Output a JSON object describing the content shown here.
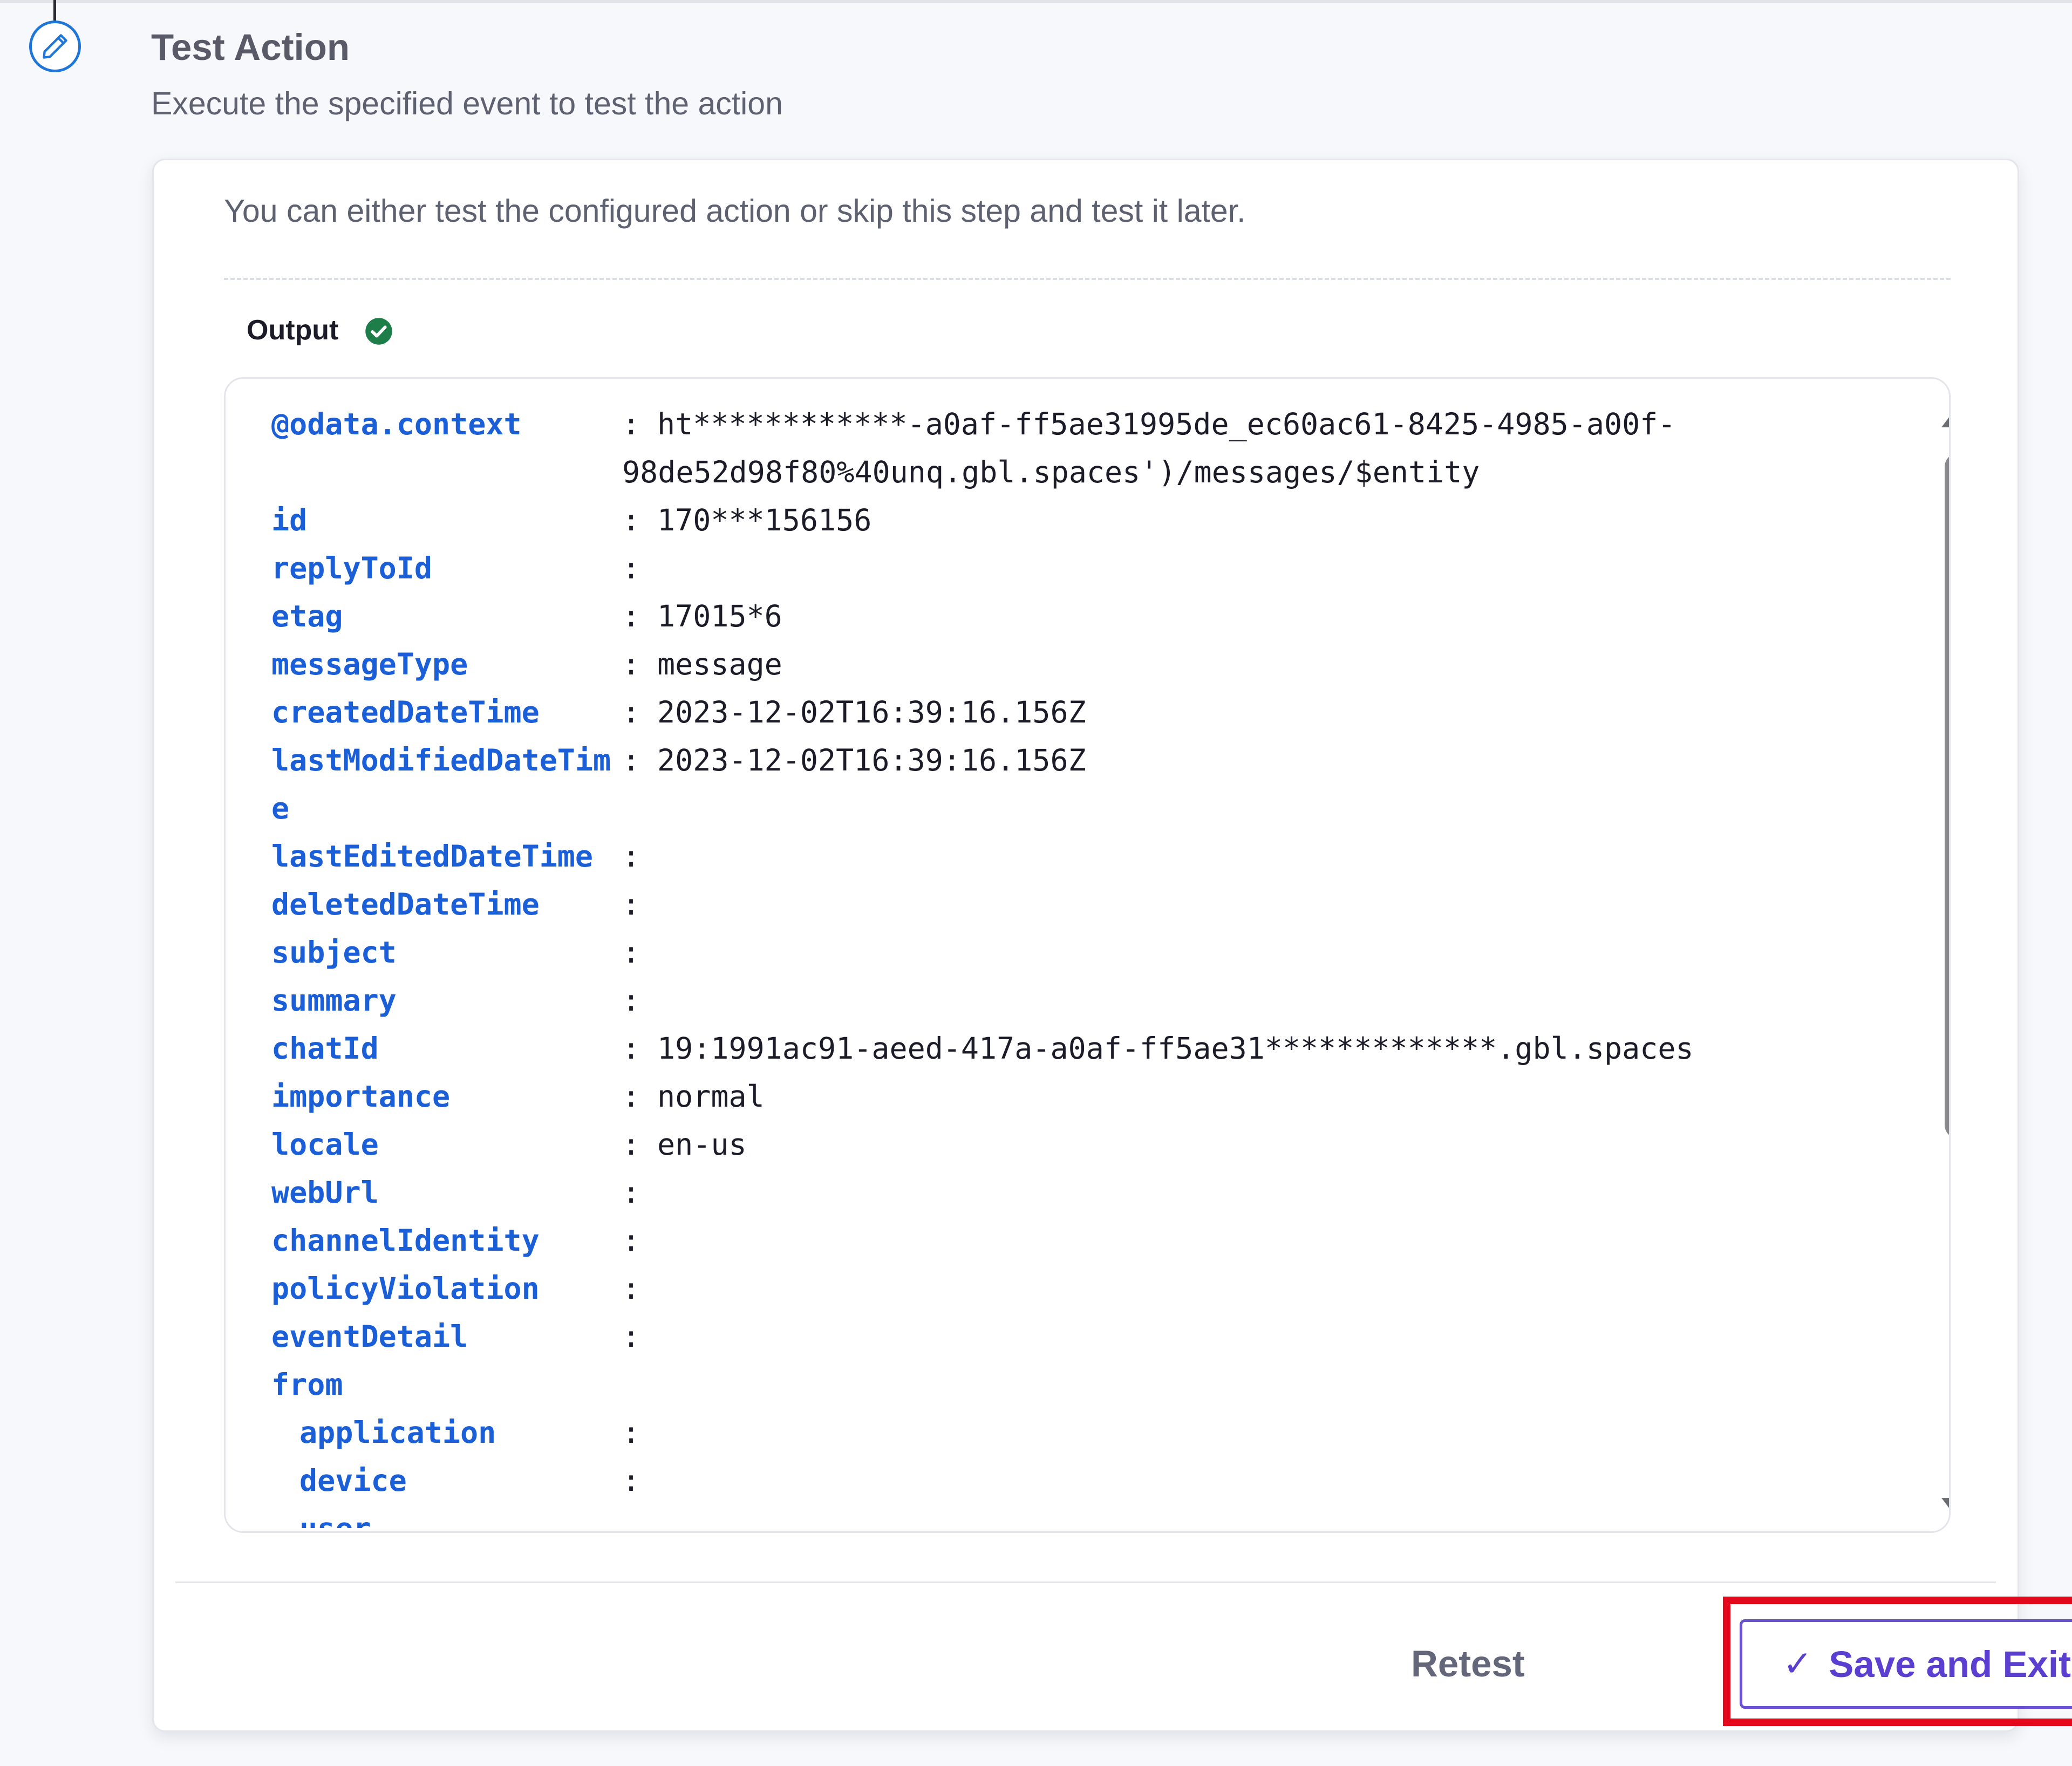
{
  "step": {
    "title": "Test Action",
    "description": "Execute the specified event to test the action",
    "icon": "pencil-icon",
    "accent_color": "#1f76d8"
  },
  "card": {
    "intro": "You can either test the configured action or skip this step and test it later.",
    "output_label": "Output",
    "output_status_icon": "check-circle-icon",
    "output_status_color": "#1e7e4a"
  },
  "output": {
    "rows": [
      {
        "key": "@odata.context",
        "value": "ht************-a0af-ff5ae31995de_ec60ac61-8425-4985-a00f-"
      },
      {
        "key": "",
        "value": "98de52d98f80%40unq.gbl.spaces')/messages/$entity"
      },
      {
        "key": "id",
        "value": "170***156156"
      },
      {
        "key": "replyToId",
        "value": ""
      },
      {
        "key": "etag",
        "value": "17015*6"
      },
      {
        "key": "messageType",
        "value": "message"
      },
      {
        "key": "createdDateTime",
        "value": "2023-12-02T16:39:16.156Z"
      },
      {
        "key": "lastModifiedDateTim",
        "value": "2023-12-02T16:39:16.156Z"
      },
      {
        "key": "e",
        "value": ""
      },
      {
        "key": "lastEditedDateTime",
        "value": ""
      },
      {
        "key": "deletedDateTime",
        "value": ""
      },
      {
        "key": "subject",
        "value": ""
      },
      {
        "key": "summary",
        "value": ""
      },
      {
        "key": "chatId",
        "value": "19:1991ac91-aeed-417a-a0af-ff5ae31*************.gbl.spaces"
      },
      {
        "key": "importance",
        "value": "normal"
      },
      {
        "key": "locale",
        "value": "en-us"
      },
      {
        "key": "webUrl",
        "value": ""
      },
      {
        "key": "channelIdentity",
        "value": ""
      },
      {
        "key": "policyViolation",
        "value": ""
      },
      {
        "key": "eventDetail",
        "value": ""
      },
      {
        "key": "from",
        "value": ""
      },
      {
        "key": "application",
        "value": ""
      },
      {
        "key": "device",
        "value": ""
      },
      {
        "key": "user",
        "value": ""
      }
    ],
    "colon": ":",
    "key_color": "#1a5fd8"
  },
  "footer": {
    "retest_label": "Retest",
    "save_exit_label": "Save and Exit",
    "save_exit_icon": "checkmark-icon",
    "save_exit_color": "#5a3fd0",
    "highlight_color": "#e2091c"
  }
}
